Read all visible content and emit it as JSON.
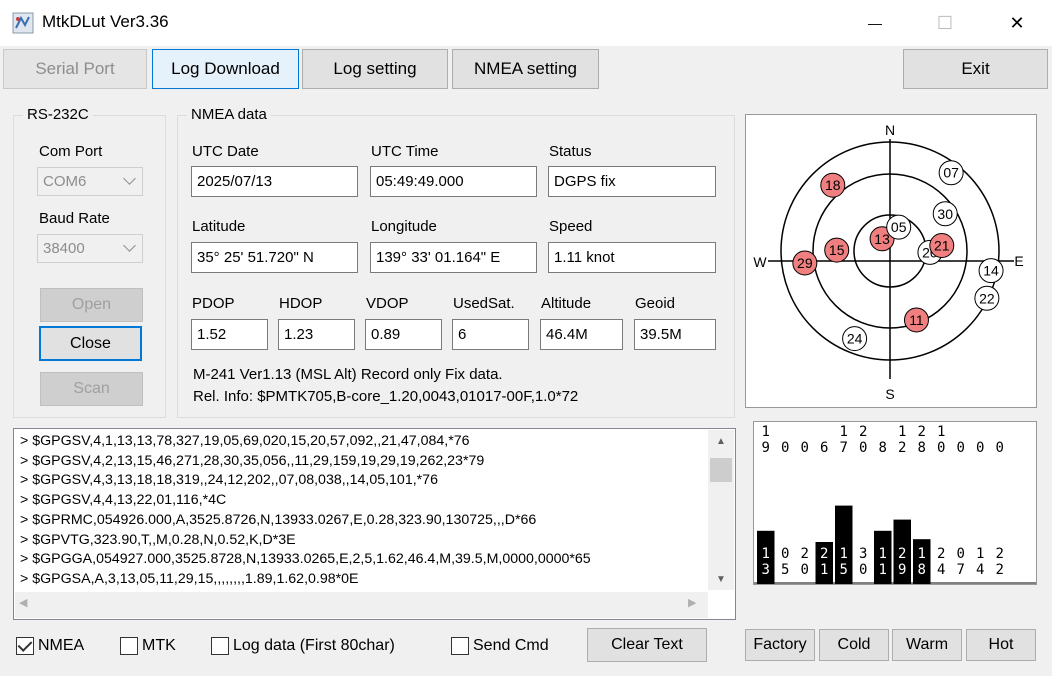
{
  "window": {
    "title": "MtkDLut Ver3.36",
    "controls": {
      "minimize": "—",
      "maximize": "☐",
      "close": "✕"
    }
  },
  "tabs": [
    {
      "label": "Serial Port",
      "state": "disabled"
    },
    {
      "label": "Log Download",
      "state": "active"
    },
    {
      "label": "Log setting",
      "state": "normal"
    },
    {
      "label": "NMEA setting",
      "state": "normal"
    }
  ],
  "exit_label": "Exit",
  "rs232c": {
    "group_label": "RS-232C",
    "com_port_label": "Com Port",
    "com_port_value": "COM6",
    "baud_rate_label": "Baud Rate",
    "baud_rate_value": "38400",
    "open_label": "Open",
    "close_label": "Close",
    "scan_label": "Scan"
  },
  "nmea": {
    "group_label": "NMEA data",
    "fields": [
      {
        "label": "UTC Date",
        "value": "2025/07/13"
      },
      {
        "label": "UTC Time",
        "value": "05:49:49.000"
      },
      {
        "label": "Status",
        "value": "DGPS fix"
      },
      {
        "label": "Latitude",
        "value": "35° 25' 51.720\" N"
      },
      {
        "label": "Longitude",
        "value": "139° 33' 01.164\" E"
      },
      {
        "label": "Speed",
        "value": "1.11 knot"
      },
      {
        "label": "PDOP",
        "value": "1.52"
      },
      {
        "label": "HDOP",
        "value": "1.23"
      },
      {
        "label": "VDOP",
        "value": "0.89"
      },
      {
        "label": "UsedSat.",
        "value": "6"
      },
      {
        "label": "Altitude",
        "value": "46.4M"
      },
      {
        "label": "Geoid",
        "value": "39.5M"
      }
    ],
    "info_line1": "M-241 Ver1.13 (MSL Alt)  Record only Fix data.",
    "info_line2": "Rel. Info: $PMTK705,B-core_1.20,0043,01017-00F,1.0*72"
  },
  "log_lines": [
    "> $GPGSV,4,1,13,13,78,327,19,05,69,020,15,20,57,092,,21,47,084,*76",
    "> $GPGSV,4,2,13,15,46,271,28,30,35,056,,11,29,159,19,29,19,262,23*79",
    "> $GPGSV,4,3,13,18,18,319,,24,12,202,,07,08,038,,14,05,101,*76",
    "> $GPGSV,4,4,13,22,01,116,*4C",
    "> $GPRMC,054926.000,A,3525.8726,N,13933.0267,E,0.28,323.90,130725,,,D*66",
    "> $GPVTG,323.90,T,,M,0.28,N,0.52,K,D*3E",
    "> $GPGGA,054927.000,3525.8728,N,13933.0265,E,2,5,1.62,46.4,M,39.5,M,0000,0000*65",
    "> $GPGSA,A,3,13,05,11,29,15,,,,,,,,1.89,1.62,0.98*0E"
  ],
  "checkboxes": [
    {
      "label": "NMEA",
      "checked": true
    },
    {
      "label": "MTK",
      "checked": false
    },
    {
      "label": "Log data (First 80char)",
      "checked": false
    },
    {
      "label": "Send Cmd",
      "checked": false
    }
  ],
  "clear_text_label": "Clear Text",
  "restart_buttons": [
    "Factory",
    "Cold",
    "Warm",
    "Hot"
  ],
  "skyplot": {
    "compass": {
      "n": "N",
      "s": "S",
      "e": "E",
      "w": "W"
    },
    "used_color": "#f08080",
    "satellites": [
      {
        "prn": "13",
        "elev": 78,
        "az": 327,
        "used": true
      },
      {
        "prn": "05",
        "elev": 69,
        "az": 20,
        "used": false
      },
      {
        "prn": "20",
        "elev": 57,
        "az": 92,
        "used": false
      },
      {
        "prn": "21",
        "elev": 47,
        "az": 84,
        "used": true
      },
      {
        "prn": "15",
        "elev": 46,
        "az": 271,
        "used": true
      },
      {
        "prn": "30",
        "elev": 35,
        "az": 56,
        "used": false
      },
      {
        "prn": "11",
        "elev": 29,
        "az": 159,
        "used": true
      },
      {
        "prn": "29",
        "elev": 19,
        "az": 262,
        "used": true
      },
      {
        "prn": "18",
        "elev": 18,
        "az": 319,
        "used": true
      },
      {
        "prn": "24",
        "elev": 12,
        "az": 202,
        "used": false
      },
      {
        "prn": "07",
        "elev": 8,
        "az": 38,
        "used": false
      },
      {
        "prn": "14",
        "elev": 5,
        "az": 101,
        "used": false
      },
      {
        "prn": "22",
        "elev": 1,
        "az": 116,
        "used": false
      }
    ]
  },
  "snr_chart": {
    "top_rows": [
      [
        "1",
        "",
        "",
        "",
        "1",
        "2",
        "",
        "1",
        "2",
        "1",
        "",
        "",
        "",
        ""
      ],
      [
        "9",
        "0",
        "0",
        "6",
        "7",
        "0",
        "8",
        "2",
        "8",
        "0",
        "0",
        "0",
        "0",
        ""
      ]
    ],
    "bars": [
      {
        "label": [
          "1",
          "3"
        ],
        "snr": 19
      },
      {
        "label": [
          "0",
          "5"
        ],
        "snr": 0
      },
      {
        "label": [
          "2",
          "0"
        ],
        "snr": 0
      },
      {
        "label": [
          "2",
          "1"
        ],
        "snr": 15
      },
      {
        "label": [
          "1",
          "5"
        ],
        "snr": 28
      },
      {
        "label": [
          "3",
          "0"
        ],
        "snr": 0
      },
      {
        "label": [
          "1",
          "1"
        ],
        "snr": 19
      },
      {
        "label": [
          "2",
          "9"
        ],
        "snr": 23
      },
      {
        "label": [
          "1",
          "8"
        ],
        "snr": 16
      },
      {
        "label": [
          "2",
          "4"
        ],
        "snr": 0
      },
      {
        "label": [
          "0",
          "7"
        ],
        "snr": 0
      },
      {
        "label": [
          "1",
          "4"
        ],
        "snr": 0
      },
      {
        "label": [
          "2",
          "2"
        ],
        "snr": 0
      }
    ]
  }
}
